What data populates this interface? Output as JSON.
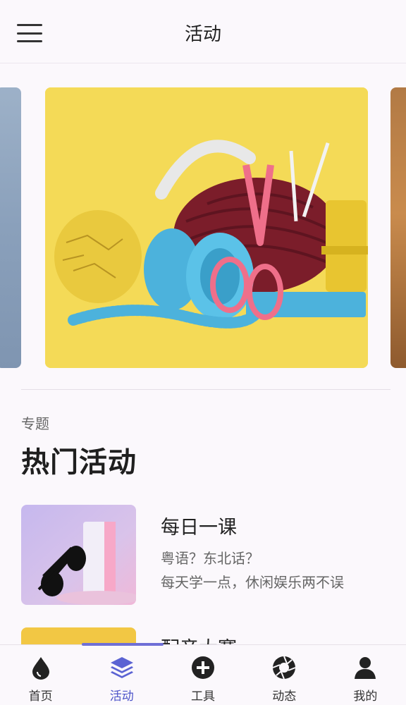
{
  "header": {
    "title": "活动",
    "menu_icon": "hamburger-menu-icon"
  },
  "section": {
    "subtitle": "专题",
    "title": "热门活动"
  },
  "cards": [
    {
      "title": "每日一课",
      "line1": "粤语？东北话？",
      "line2": "每天学一点，休闲娱乐两不误"
    },
    {
      "title": "配音大赛",
      "line1": "",
      "line2": ""
    }
  ],
  "nav": {
    "items": [
      {
        "label": "首页",
        "icon": "drop-icon"
      },
      {
        "label": "活动",
        "icon": "layers-icon"
      },
      {
        "label": "工具",
        "icon": "add-circle-icon"
      },
      {
        "label": "动态",
        "icon": "aperture-icon"
      },
      {
        "label": "我的",
        "icon": "person-icon"
      }
    ],
    "active": "活动"
  },
  "colors": {
    "accent": "#4d55c9",
    "background": "#fbf8fc",
    "banner_yellow": "#f4da57"
  }
}
